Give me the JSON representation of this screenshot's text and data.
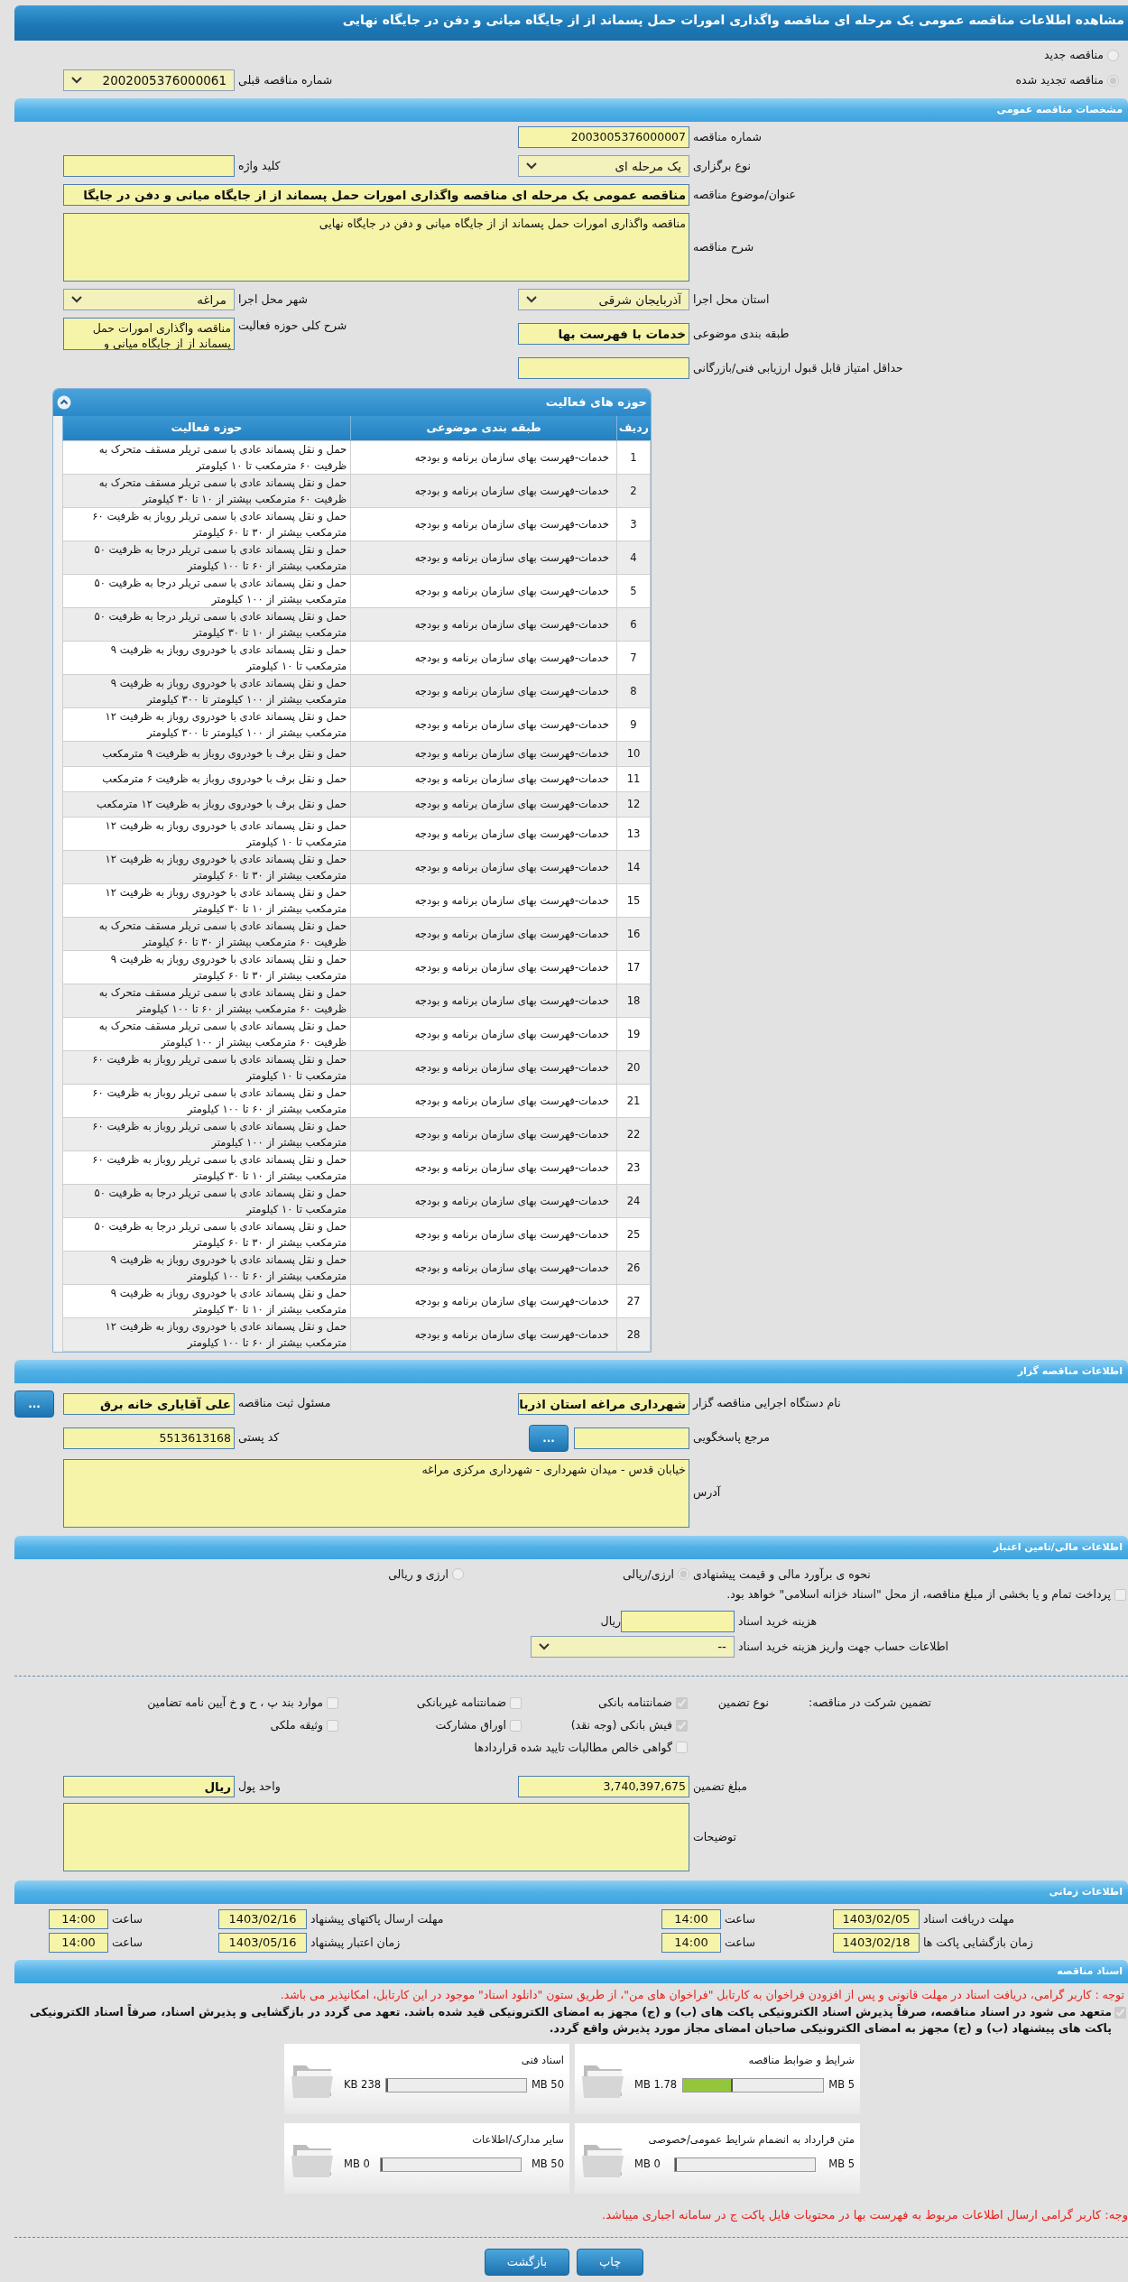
{
  "title": "مشاهده اطلاعات مناقصه عمومی یک مرحله ای مناقصه واگذاری امورات حمل پسماند از از جایگاه میانی و دفن در جایگاه نهایی",
  "tender_status": [
    {
      "label": "مناقصه جدید",
      "selected": false
    },
    {
      "label": "مناقصه تجدید شده",
      "selected": true
    }
  ],
  "previous_tender": {
    "label": "شماره مناقصه قبلی",
    "value": "2002005376000061",
    "kind": "select"
  },
  "general": {
    "title": "مشخصات مناقصه عمومی",
    "rows": [
      [
        {
          "label": "شماره مناقصه",
          "value": "2003005376000007",
          "kind": "input"
        }
      ],
      [
        {
          "label": "نوع برگزاری",
          "value": "یک مرحله ای",
          "kind": "select"
        },
        {
          "label": "کلید واژه",
          "kind": "input"
        }
      ],
      [
        {
          "label": "عنوان/موضوع مناقصه",
          "value": "مناقصه عمومی یک مرحله ای مناقصه واگذاری امورات حمل پسماند از از جایگاه میانی و دفن در جایگا",
          "kind": "wide_input",
          "bold": true
        }
      ],
      [
        {
          "label": "شرح مناقصه",
          "value": "مناقصه واگذاری امورات حمل پسماند از از جایگاه میانی و دفن در جایگاه نهایی",
          "kind": "wide_textarea"
        }
      ],
      [
        {
          "label": "استان محل اجرا",
          "value": "آذربایجان شرقی",
          "kind": "select"
        },
        {
          "label": "شهر محل اجرا",
          "value": "مراغه",
          "kind": "select"
        }
      ],
      [
        {
          "label": "طبقه بندی موضوعی",
          "value": "خدمات با فهرست بها",
          "kind": "input",
          "bold": true
        },
        {
          "label": "شرح کلی حوزه فعالیت",
          "value": "مناقصه واگذاری امورات حمل پسماند از از جایگاه میانی و",
          "kind": "textarea"
        }
      ],
      [
        {
          "label": "حداقل امتیاز قابل قبول ارزیابی فنی/بازرگانی",
          "kind": "input"
        }
      ]
    ]
  },
  "activities": {
    "title": "حوزه های فعالیت",
    "columns": [
      "ردیف",
      "طبقه بندی موضوعی",
      "حوزه فعالیت"
    ],
    "rows": [
      [
        "1",
        "خدمات-فهرست بهای سازمان برنامه و بودجه",
        "حمل و نقل پسماند عادی با سمی تریلر مسقف متحرک به ظرفیت ۶۰ مترمکعب تا ۱۰ کیلومتر"
      ],
      [
        "2",
        "خدمات-فهرست بهای سازمان برنامه و بودجه",
        "حمل و نقل پسماند عادی با سمی تریلر مسقف متحرک به ظرفیت ۶۰ مترمکعب بیشتر از ۱۰ تا ۳۰ کیلومتر"
      ],
      [
        "3",
        "خدمات-فهرست بهای سازمان برنامه و بودجه",
        "حمل و نقل پسماند عادی با سمی تریلر روباز به ظرفیت ۶۰ مترمکعب بیشتر از ۳۰ تا ۶۰ کیلومتر"
      ],
      [
        "4",
        "خدمات-فهرست بهای سازمان برنامه و بودجه",
        "حمل و نقل پسماند عادی با سمی تریلر درجا به ظرفیت ۵۰ مترمکعب بیشتر از ۶۰ تا ۱۰۰ کیلومتر"
      ],
      [
        "5",
        "خدمات-فهرست بهای سازمان برنامه و بودجه",
        "حمل و نقل پسماند عادی با سمی تریلر درجا به ظرفیت ۵۰ مترمکعب بیشتر از ۱۰۰ کیلومتر"
      ],
      [
        "6",
        "خدمات-فهرست بهای سازمان برنامه و بودجه",
        "حمل و نقل پسماند عادی با سمی تریلر درجا به ظرفیت ۵۰ مترمکعب بیشتر از ۱۰ تا ۳۰ کیلومتر"
      ],
      [
        "7",
        "خدمات-فهرست بهای سازمان برنامه و بودجه",
        "حمل و نقل پسماند عادی با خودروی روباز به ظرفیت ۹ مترمکعب تا ۱۰ کیلومتر"
      ],
      [
        "8",
        "خدمات-فهرست بهای سازمان برنامه و بودجه",
        "حمل و نقل پسماند عادی با خودروی روباز به ظرفیت ۹ مترمکعب بیشتر از ۱۰۰ کیلومتر تا ۳۰۰ کیلومتر"
      ],
      [
        "9",
        "خدمات-فهرست بهای سازمان برنامه و بودجه",
        "حمل و نقل پسماند عادی با خودروی روباز به ظرفیت ۱۲ مترمکعب بیشتر از ۱۰۰ کیلومتر تا ۳۰۰ کیلومتر"
      ],
      [
        "10",
        "خدمات-فهرست بهای سازمان برنامه و بودجه",
        "حمل و نقل برف با خودروی روباز به ظرفیت ۹ مترمکعب"
      ],
      [
        "11",
        "خدمات-فهرست بهای سازمان برنامه و بودجه",
        "حمل و نقل برف با خودروی روباز به ظرفیت ۶ مترمکعب"
      ],
      [
        "12",
        "خدمات-فهرست بهای سازمان برنامه و بودجه",
        "حمل و نقل برف با خودروی روباز به ظرفیت ۱۲ مترمکعب"
      ],
      [
        "13",
        "خدمات-فهرست بهای سازمان برنامه و بودجه",
        "حمل و نقل پسماند عادی با خودروی روباز به ظرفیت ۱۲ مترمکعب تا ۱۰ کیلومتر"
      ],
      [
        "14",
        "خدمات-فهرست بهای سازمان برنامه و بودجه",
        "حمل و نقل پسماند عادی با خودروی روباز به ظرفیت ۱۲ مترمکعب بیشتر از ۳۰ تا ۶۰ کیلومتر"
      ],
      [
        "15",
        "خدمات-فهرست بهای سازمان برنامه و بودجه",
        "حمل و نقل پسماند عادی با خودروی روباز به ظرفیت ۱۲ مترمکعب بیشتر از ۱۰ تا ۳۰ کیلومتر"
      ],
      [
        "16",
        "خدمات-فهرست بهای سازمان برنامه و بودجه",
        "حمل و نقل پسماند عادی با سمی تریلر مسقف متحرک به ظرفیت ۶۰ مترمکعب بیشتر از ۳۰ تا ۶۰ کیلومتر"
      ],
      [
        "17",
        "خدمات-فهرست بهای سازمان برنامه و بودجه",
        "حمل و نقل پسماند عادی با خودروی روباز به ظرفیت ۹ مترمکعب بیشتر از ۳۰ تا ۶۰ کیلومتر"
      ],
      [
        "18",
        "خدمات-فهرست بهای سازمان برنامه و بودجه",
        "حمل و نقل پسماند عادی با سمی تریلر مسقف متحرک به ظرفیت ۶۰ مترمکعب بیشتر از ۶۰ تا ۱۰۰ کیلومتر"
      ],
      [
        "19",
        "خدمات-فهرست بهای سازمان برنامه و بودجه",
        "حمل و نقل پسماند عادی با سمی تریلر مسقف متحرک به ظرفیت ۶۰ مترمکعب بیشتر از ۱۰۰ کیلومتر"
      ],
      [
        "20",
        "خدمات-فهرست بهای سازمان برنامه و بودجه",
        "حمل و نقل پسماند عادی با سمی تریلر روباز به ظرفیت ۶۰ مترمکعب تا ۱۰ کیلومتر"
      ],
      [
        "21",
        "خدمات-فهرست بهای سازمان برنامه و بودجه",
        "حمل و نقل پسماند عادی با سمی تریلر روباز به ظرفیت ۶۰ مترمکعب بیشتر از ۶۰ تا ۱۰۰ کیلومتر"
      ],
      [
        "22",
        "خدمات-فهرست بهای سازمان برنامه و بودجه",
        "حمل و نقل پسماند عادی با سمی تریلر روباز به ظرفیت ۶۰ مترمکعب بیشتر از ۱۰۰ کیلومتر"
      ],
      [
        "23",
        "خدمات-فهرست بهای سازمان برنامه و بودجه",
        "حمل و نقل پسماند عادی با سمی تریلر روباز به ظرفیت ۶۰ مترمکعب بیشتر از ۱۰ تا ۳۰ کیلومتر"
      ],
      [
        "24",
        "خدمات-فهرست بهای سازمان برنامه و بودجه",
        "حمل و نقل پسماند عادی با سمی تریلر درجا به ظرفیت ۵۰ مترمکعب تا ۱۰ کیلومتر"
      ],
      [
        "25",
        "خدمات-فهرست بهای سازمان برنامه و بودجه",
        "حمل و نقل پسماند عادی با سمی تریلر درجا به ظرفیت ۵۰ مترمکعب بیشتر از ۳۰ تا ۶۰ کیلومتر"
      ],
      [
        "26",
        "خدمات-فهرست بهای سازمان برنامه و بودجه",
        "حمل و نقل پسماند عادی با خودروی روباز به ظرفیت ۹ مترمکعب بیشتر از ۶۰ تا ۱۰۰ کیلومتر"
      ],
      [
        "27",
        "خدمات-فهرست بهای سازمان برنامه و بودجه",
        "حمل و نقل پسماند عادی با خودروی روباز به ظرفیت ۹ مترمکعب بیشتر از ۱۰ تا ۳۰ کیلومتر"
      ],
      [
        "28",
        "خدمات-فهرست بهای سازمان برنامه و بودجه",
        "حمل و نقل پسماند عادی با خودروی روباز به ظرفیت ۱۲ مترمکعب بیشتر از ۶۰ تا ۱۰۰ کیلومتر"
      ]
    ]
  },
  "organizer": {
    "title": "اطلاعات مناقصه گزار",
    "rows": [
      [
        {
          "label": "نام دستگاه اجرایی مناقصه گزار",
          "value": "شهرداری مراغه استان اذربا",
          "kind": "input",
          "bold": true
        },
        {
          "label": "مسئول ثبت مناقصه",
          "value": "علی آقایاری خانه برق",
          "kind": "lookup",
          "bold": true,
          "button": "..."
        }
      ],
      [
        {
          "label": "مرجع پاسخگویی",
          "kind": "lookup",
          "button": "..."
        },
        {
          "label": "کد پستی",
          "value": "5513613168",
          "kind": "input"
        }
      ],
      [
        {
          "label": "آدرس",
          "value": "خیابان قدس - میدان شهرداری - شهرداری مرکزی مراغه",
          "kind": "wide_textarea"
        }
      ]
    ]
  },
  "finance": {
    "title": "اطلاعات مالی/تامین اعتبار",
    "estimate": {
      "label": "نحوه ی برآورد مالی و قیمت پیشنهادی",
      "options": [
        {
          "label": "ارزی/ریالی",
          "selected": true
        },
        {
          "label": "ارزی و ریالی",
          "selected": false
        }
      ]
    },
    "treasury": {
      "label": "پرداخت تمام و یا بخشی از مبلغ مناقصه، از محل \"اسناد خزانه اسلامی\" خواهد بود.",
      "checked": false
    },
    "doc_fee": {
      "label": "هزینه خرید اسناد",
      "unit": "ریال"
    },
    "account": {
      "label": "اطلاعات حساب جهت واریز هزینه خرید اسناد",
      "value": "--"
    }
  },
  "guarantee": {
    "label": "تضمین شرکت در مناقصه:",
    "type_label": "نوع تضمین",
    "options": [
      {
        "label": "ضمانتنامه بانکی",
        "checked": true
      },
      {
        "label": "ضمانتنامه غیربانکی",
        "checked": false
      },
      {
        "label": "موارد بند پ ، ح و خ آیین نامه تضامین",
        "checked": false
      },
      {
        "label": "فیش بانکی (وجه نقد)",
        "checked": true
      },
      {
        "label": "اوراق مشارکت",
        "checked": false
      },
      {
        "label": "وثیقه ملکی",
        "checked": false
      },
      {
        "label": "گواهی خالص مطالبات تایید شده قراردادها",
        "checked": false
      }
    ],
    "rows": [
      [
        {
          "label": "مبلغ تضمین",
          "value": "3,740,397,675",
          "kind": "input"
        },
        {
          "label": "واحد پول",
          "value": "ریال",
          "kind": "input",
          "bold": true
        }
      ],
      [
        {
          "label": "توضیحات",
          "kind": "wide_textarea"
        }
      ]
    ]
  },
  "timing": {
    "title": "اطلاعات زمانی",
    "items": [
      {
        "label": "مهلت دریافت اسناد",
        "date": "1403/02/05",
        "time_label": "ساعت",
        "time": "14:00"
      },
      {
        "label": "مهلت ارسال پاکتهای پیشنهاد",
        "date": "1403/02/16",
        "time_label": "ساعت",
        "time": "14:00"
      },
      {
        "label": "زمان بازگشایی پاکت ها",
        "date": "1403/02/18",
        "time_label": "ساعت",
        "time": "14:00"
      },
      {
        "label": "زمان اعتبار پیشنهاد",
        "date": "1403/05/16",
        "time_label": "ساعت",
        "time": "14:00"
      }
    ]
  },
  "documents": {
    "title": "اسناد مناقصه",
    "notice": "توجه : کاربر گرامی، دریافت اسناد در مهلت قانونی و پس از افزودن فراخوان به کارتابل \"فراخوان های من\"، از طریق ستون \"دانلود اسناد\" موجود در این کارتابل، امکانپذیر می باشد.",
    "pledge": {
      "text": "متعهد می شود در اسناد مناقصه، صرفاً پذیرش اسناد الکترونیکی پاکت های (ب) و (ج) مجهز به امضای الکترونیکی قید شده باشد. تعهد می گردد در بازگشایی و پذیرش اسناد، صرفاً اسناد الکترونیکی پاکت های پیشنهاد (ب) و (ج) مجهز به امضای الکترونیکی صاحبان امضای مجاز مورد پذیرش واقع گردد.",
      "checked": true
    },
    "files": [
      {
        "name": "شرایط و ضوابط مناقصه",
        "max": "5 MB",
        "size": "1.78 MB",
        "level": 0.356
      },
      {
        "name": "اسناد فنی",
        "max": "50 MB",
        "size": "238 KB",
        "level": 0.005
      },
      {
        "name": "متن قرارداد به انضمام شرایط عمومی/خصوصی",
        "max": "5 MB",
        "size": "0 MB",
        "level": 0
      },
      {
        "name": "سایر مدارک/اطلاعات",
        "max": "50 MB",
        "size": "0 MB",
        "level": 0
      }
    ],
    "footer_note": "وجه: کاربر گرامی ارسال اطلاعات مربوط به فهرست بها در محتویات فایل پاکت ج در سامانه اجباری میباشد."
  },
  "buttons": [
    "چاپ",
    "بازگشت"
  ]
}
